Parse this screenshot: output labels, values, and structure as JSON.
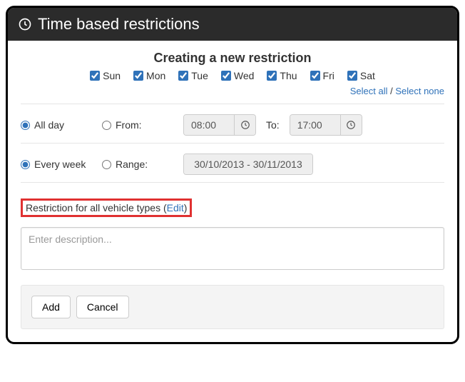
{
  "header": {
    "title": "Time based restrictions"
  },
  "subtitle": "Creating a new restriction",
  "days": [
    {
      "label": "Sun",
      "checked": true
    },
    {
      "label": "Mon",
      "checked": true
    },
    {
      "label": "Tue",
      "checked": true
    },
    {
      "label": "Wed",
      "checked": true
    },
    {
      "label": "Thu",
      "checked": true
    },
    {
      "label": "Fri",
      "checked": true
    },
    {
      "label": "Sat",
      "checked": true
    }
  ],
  "select_links": {
    "all": "Select all",
    "sep": " / ",
    "none": "Select none"
  },
  "time": {
    "allday_label": "All day",
    "from_label": "From:",
    "from_value": "08:00",
    "to_label": "To:",
    "to_value": "17:00"
  },
  "week": {
    "every_label": "Every week",
    "range_label": "Range:",
    "range_value": "30/10/2013 - 30/11/2013"
  },
  "restriction": {
    "text": "Restriction for all vehicle types ",
    "edit_open": "(",
    "edit_label": "Edit",
    "edit_close": ")"
  },
  "description": {
    "placeholder": "Enter description..."
  },
  "buttons": {
    "add": "Add",
    "cancel": "Cancel"
  }
}
